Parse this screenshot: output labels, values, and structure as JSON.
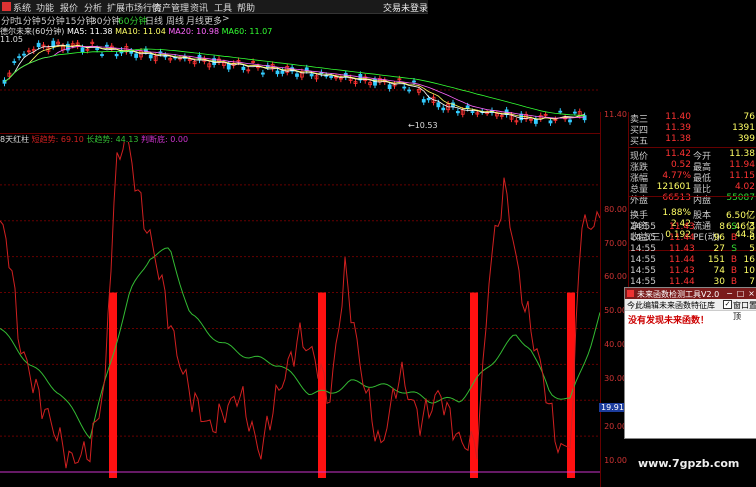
{
  "menu": {
    "items": [
      "系统",
      "功能",
      "报价",
      "分析",
      "扩展市场行情",
      "资产管理",
      "资讯",
      "工具",
      "帮助"
    ],
    "login": "交易未登录"
  },
  "periods": {
    "items": [
      "分时",
      "1分钟",
      "5分钟",
      "15分钟",
      "30分钟",
      "60分钟",
      "日线",
      "周线",
      "月线",
      "更多"
    ],
    "active": "60分钟",
    "more_arrow": ">"
  },
  "ma_legend": {
    "title": "德尔未来(60分钟)",
    "ma5": "MA5: 11.38",
    "ma10": "MA10: 11.04",
    "ma20": "MA20: 10.98",
    "ma60": "MA60: 11.07",
    "ma5_color": "#ffffff",
    "ma10_color": "#ffff66",
    "ma20_color": "#ff66ff",
    "ma60_color": "#33ff33"
  },
  "kline": {
    "top_label": "11.05",
    "low_label": "←10.53",
    "price_label": "11.40"
  },
  "indicator": {
    "name": "8天红柱",
    "short": "短趋势: 69.10",
    "long": "长趋势: 44.13",
    "judge": "判断底: 0.00",
    "short_color": "#d02020",
    "long_color": "#33bb33",
    "judge_color": "#cc33cc",
    "y_ticks": [
      "80.00",
      "70.00",
      "60.00",
      "50.00",
      "40.00",
      "30.00",
      "20.00",
      "10.00"
    ],
    "current_value": "19.91",
    "bar_color": "#ff1111"
  },
  "quote": {
    "rows": [
      {
        "l": "卖三",
        "v": "11.40",
        "r": "",
        "rv": "76"
      },
      {
        "l": "买四",
        "v": "11.39",
        "r": "",
        "rv": "1391"
      },
      {
        "l": "买五",
        "v": "11.38",
        "r": "",
        "rv": "399"
      },
      {
        "l": "现价",
        "v": "11.42",
        "r": "今开",
        "rv": "11.38"
      },
      {
        "l": "涨跌",
        "v": "0.52",
        "r": "最高",
        "rv": "11.94"
      },
      {
        "l": "涨幅",
        "v": "4.77%",
        "r": "最低",
        "rv": "11.15"
      },
      {
        "l": "总量",
        "v": "121601",
        "r": "量比",
        "rv": "4.02"
      },
      {
        "l": "外盘",
        "v": "66513",
        "r": "内盘",
        "rv": "55087"
      },
      {
        "l": "换手",
        "v": "1.88%",
        "r": "股本",
        "rv": "6.50亿"
      },
      {
        "l": "净资",
        "v": "2.42",
        "r": "流通",
        "rv": "6.46亿"
      },
      {
        "l": "收益(三)",
        "v": "0.192",
        "r": "PE(动)",
        "rv": "44.5"
      }
    ],
    "ticks": [
      {
        "t": "14:55",
        "p": "11.43",
        "n": "8",
        "s": "S",
        "x": "3"
      },
      {
        "t": "14:55",
        "p": "11.44",
        "n": "96",
        "s": "B",
        "x": "6"
      },
      {
        "t": "14:55",
        "p": "11.43",
        "n": "27",
        "s": "S",
        "x": "5"
      },
      {
        "t": "14:55",
        "p": "11.44",
        "n": "151",
        "s": "B",
        "x": "16"
      },
      {
        "t": "14:55",
        "p": "11.43",
        "n": "74",
        "s": "B",
        "x": "10"
      },
      {
        "t": "14:55",
        "p": "11.44",
        "n": "30",
        "s": "B",
        "x": "7"
      }
    ]
  },
  "dialog": {
    "title": "未来函数检测工具V2.0",
    "toolbar_left": "今此编辑未来函数特征库",
    "toolbar_right": "窗口置顶",
    "message": "没有发现未来函数！",
    "min": "−",
    "max": "□",
    "close": "×"
  },
  "watermark": "www.7gpzb.com"
}
